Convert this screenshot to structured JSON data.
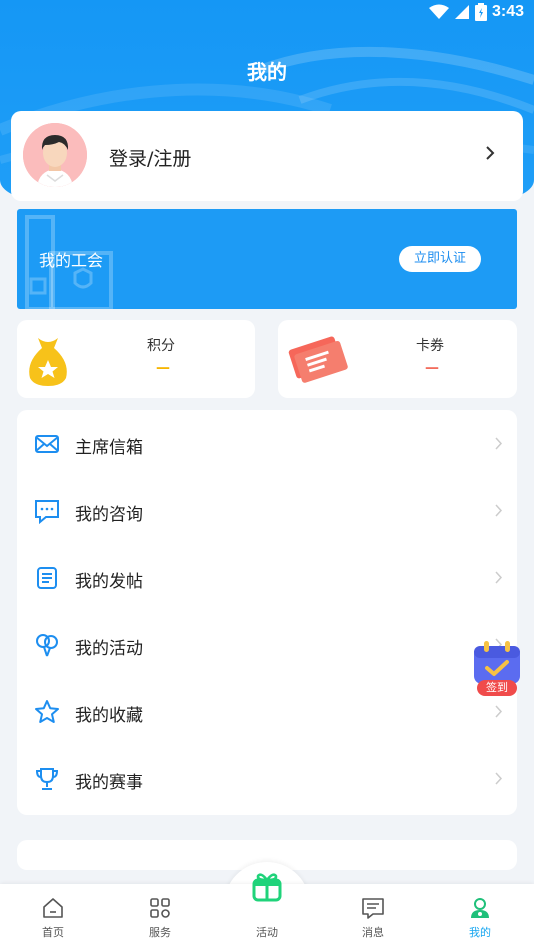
{
  "statusbar": {
    "time": "3:43",
    "icons": [
      "wifi-icon",
      "signal-icon",
      "battery-icon"
    ]
  },
  "header": {
    "title": "我的"
  },
  "login": {
    "label": "登录/注册"
  },
  "union": {
    "title": "我的工会",
    "button_label": "立即认证"
  },
  "stats": {
    "points": {
      "label": "积分",
      "value": "—"
    },
    "coupons": {
      "label": "卡券",
      "value": "—"
    }
  },
  "menu": {
    "items": [
      {
        "label": "主席信箱",
        "icon": "mail-icon"
      },
      {
        "label": "我的咨询",
        "icon": "chat-icon"
      },
      {
        "label": "我的发帖",
        "icon": "document-icon"
      },
      {
        "label": "我的活动",
        "icon": "balloon-icon"
      },
      {
        "label": "我的收藏",
        "icon": "star-icon"
      },
      {
        "label": "我的赛事",
        "icon": "trophy-icon"
      }
    ]
  },
  "checkin": {
    "label": "签到"
  },
  "tabbar": {
    "tabs": [
      {
        "label": "首页",
        "icon": "home-icon"
      },
      {
        "label": "服务",
        "icon": "grid-icon"
      },
      {
        "label": "活动",
        "icon": "gift-icon"
      },
      {
        "label": "消息",
        "icon": "message-icon"
      },
      {
        "label": "我的",
        "icon": "profile-icon"
      }
    ],
    "active_index": 4
  },
  "colors": {
    "primary": "#1d9bf5",
    "points": "#f7b500",
    "coupons": "#f36c5c",
    "active_tab": "#16a6f0",
    "gift": "#1fd37a"
  }
}
